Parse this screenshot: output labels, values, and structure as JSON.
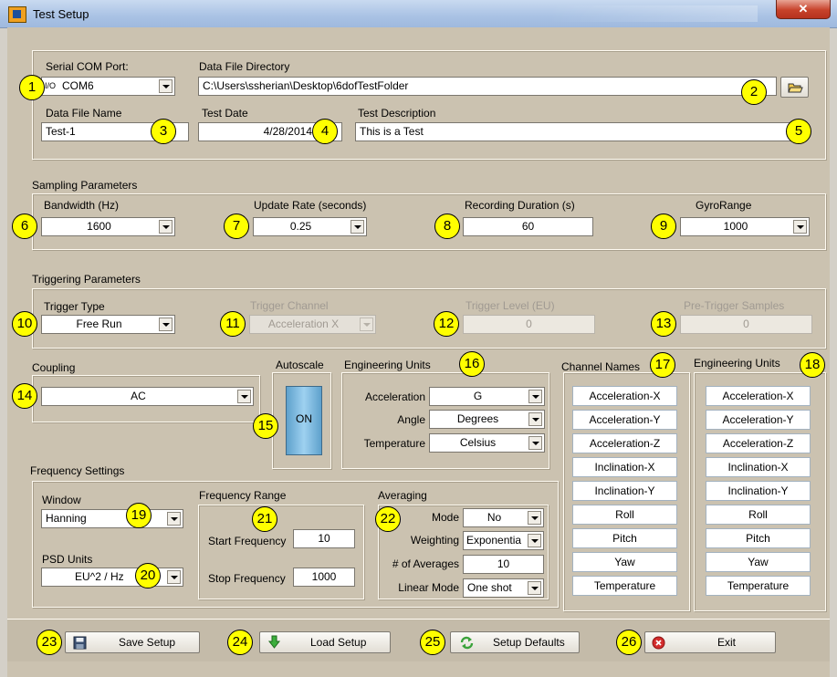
{
  "window": {
    "title": "Test Setup",
    "close_glyph": "✕",
    "app_icon": "labview-vi-icon"
  },
  "file_section": {
    "com_port": {
      "label": "Serial COM Port:",
      "io_glyph": "I/O",
      "value": "COM6"
    },
    "directory": {
      "label": "Data File Directory",
      "value": "C:\\Users\\ssherian\\Desktop\\6dofTestFolder",
      "browse_icon": "folder-icon"
    },
    "file_name": {
      "label": "Data File Name",
      "value": "Test-1"
    },
    "test_date": {
      "label": "Test Date",
      "value": "4/28/2014"
    },
    "test_description": {
      "label": "Test Description",
      "value": "This is a Test"
    }
  },
  "sampling": {
    "title": "Sampling Parameters",
    "bandwidth": {
      "label": "Bandwidth (Hz)",
      "value": "1600"
    },
    "update_rate": {
      "label": "Update Rate (seconds)",
      "value": "0.25"
    },
    "recording_duration": {
      "label": "Recording Duration (s)",
      "value": "60"
    },
    "gyro_range": {
      "label": "GyroRange",
      "value": "1000"
    }
  },
  "triggering": {
    "title": "Triggering Parameters",
    "trigger_type": {
      "label": "Trigger Type",
      "value": "Free Run"
    },
    "trigger_channel": {
      "label": "Trigger Channel",
      "value": "Acceleration X"
    },
    "trigger_level": {
      "label": "Trigger Level (EU)",
      "value": "0"
    },
    "pre_trigger": {
      "label": "Pre-Trigger Samples",
      "value": "0"
    }
  },
  "coupling": {
    "title": "Coupling",
    "value": "AC"
  },
  "autoscale": {
    "title": "Autoscale",
    "button": "ON"
  },
  "engineering_units": {
    "title": "Engineering Units",
    "rows": [
      {
        "label": "Acceleration",
        "value": "G"
      },
      {
        "label": "Angle",
        "value": "Degrees"
      },
      {
        "label": "Temperature",
        "value": "Celsius"
      }
    ]
  },
  "channel_names": {
    "title": "Channel Names",
    "items": [
      "Acceleration-X",
      "Acceleration-Y",
      "Acceleration-Z",
      "Inclination-X",
      "Inclination-Y",
      "Roll",
      "Pitch",
      "Yaw",
      "Temperature"
    ]
  },
  "channel_units": {
    "title": "Engineering Units",
    "items": [
      "Acceleration-X",
      "Acceleration-Y",
      "Acceleration-Z",
      "Inclination-X",
      "Inclination-Y",
      "Roll",
      "Pitch",
      "Yaw",
      "Temperature"
    ]
  },
  "frequency": {
    "title": "Frequency Settings",
    "window": {
      "label": "Window",
      "value": "Hanning"
    },
    "psd_units": {
      "label": "PSD Units",
      "value": "EU^2 / Hz"
    },
    "range": {
      "title": "Frequency Range",
      "start": {
        "label": "Start Frequency",
        "value": "10"
      },
      "stop": {
        "label": "Stop Frequency",
        "value": "1000"
      }
    },
    "averaging": {
      "title": "Averaging",
      "mode": {
        "label": "Mode",
        "value": "No"
      },
      "weighting": {
        "label": "Weighting",
        "value": "Exponentia"
      },
      "num_averages": {
        "label": "# of Averages",
        "value": "10"
      },
      "linear_mode": {
        "label": "Linear Mode",
        "value": "One shot"
      }
    }
  },
  "buttons": {
    "save": {
      "label": "Save Setup",
      "icon": "floppy-disk-icon"
    },
    "load": {
      "label": "Load Setup",
      "icon": "download-arrow-icon"
    },
    "defaults": {
      "label": "Setup Defaults",
      "icon": "refresh-icon"
    },
    "exit": {
      "label": "Exit",
      "icon": "red-x-icon"
    }
  },
  "callouts": [
    "1",
    "2",
    "3",
    "4",
    "5",
    "6",
    "7",
    "8",
    "9",
    "10",
    "11",
    "12",
    "13",
    "14",
    "15",
    "16",
    "17",
    "18",
    "19",
    "20",
    "21",
    "22",
    "23",
    "24",
    "25",
    "26"
  ],
  "colors": {
    "panel": "#cbc2b0",
    "callout": "#ffff00",
    "on_button": "#7ab8e0"
  }
}
